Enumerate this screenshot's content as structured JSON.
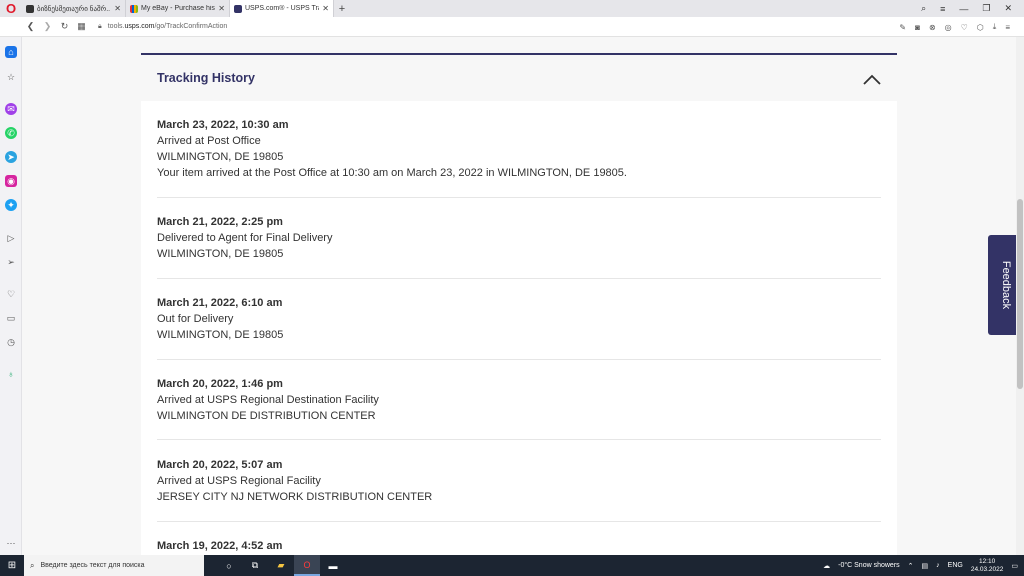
{
  "browser": {
    "tabs": [
      {
        "title": "ბიზნესმეთაური ნაშრ..",
        "active": false,
        "color": "#333333"
      },
      {
        "title": "My eBay - Purchase history",
        "active": false,
        "color": "#e53238"
      },
      {
        "title": "USPS.com® - USPS Tracki..",
        "active": true,
        "color": "#333366"
      }
    ],
    "new_tab": "+",
    "url_prefix": "tools.",
    "url_domain": "usps.com",
    "url_path": "/go/TrackConfirmAction"
  },
  "tracking": {
    "title": "Tracking History",
    "events": [
      {
        "date": "March 23, 2022, 10:30 am",
        "status": "Arrived at Post Office",
        "location": "WILMINGTON, DE 19805",
        "detail": "Your item arrived at the Post Office at 10:30 am on March 23, 2022 in WILMINGTON, DE 19805."
      },
      {
        "date": "March 21, 2022, 2:25 pm",
        "status": "Delivered to Agent for Final Delivery",
        "location": "WILMINGTON, DE 19805"
      },
      {
        "date": "March 21, 2022, 6:10 am",
        "status": "Out for Delivery",
        "location": "WILMINGTON, DE 19805"
      },
      {
        "date": "March 20, 2022, 1:46 pm",
        "status": "Arrived at USPS Regional Destination Facility",
        "location": "WILMINGTON DE DISTRIBUTION CENTER"
      },
      {
        "date": "March 20, 2022, 5:07 am",
        "status": "Arrived at USPS Regional Facility",
        "location": "JERSEY CITY NJ NETWORK DISTRIBUTION CENTER"
      },
      {
        "date": "March 19, 2022, 4:52 am"
      }
    ]
  },
  "feedback_label": "Feedback",
  "taskbar": {
    "search_placeholder": "Введите здесь текст для поиска",
    "weather": "-0°C  Snow showers",
    "lang": "ENG",
    "time": "12:10",
    "date": "24.03.2022"
  },
  "colors": {
    "brand": "#333366",
    "opera": "#e0192b"
  }
}
